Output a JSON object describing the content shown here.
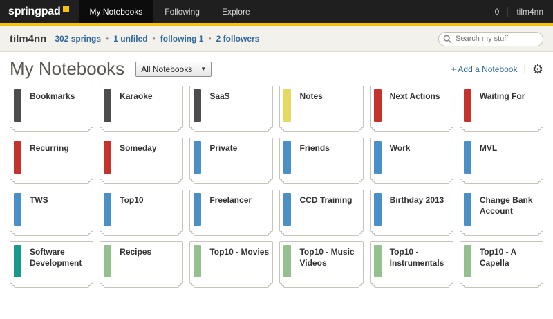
{
  "header": {
    "logo_text": "springpad",
    "tabs": [
      {
        "label": "My Notebooks",
        "active": true
      },
      {
        "label": "Following",
        "active": false
      },
      {
        "label": "Explore",
        "active": false
      }
    ],
    "notification_count": "0",
    "username": "tilm4nn"
  },
  "userbar": {
    "username": "tilm4nn",
    "stats": [
      {
        "label": "302 springs"
      },
      {
        "label": "1 unfiled"
      },
      {
        "label": "following 1"
      },
      {
        "label": "2 followers"
      }
    ],
    "search_placeholder": "Search my stuff"
  },
  "main": {
    "title": "My Notebooks",
    "filter_selected": "All Notebooks",
    "add_notebook_label": "+ Add a Notebook"
  },
  "colors": {
    "accent_yellow": "#f5c206",
    "link_blue": "#33699c"
  },
  "notebooks": [
    {
      "title": "Bookmarks",
      "color": "#4d4d4d"
    },
    {
      "title": "Karaoke",
      "color": "#4d4d4d"
    },
    {
      "title": "SaaS",
      "color": "#4d4d4d"
    },
    {
      "title": "Notes",
      "color": "#e4da62"
    },
    {
      "title": "Next Actions",
      "color": "#c4342d"
    },
    {
      "title": "Waiting For",
      "color": "#c4342d"
    },
    {
      "title": "Recurring",
      "color": "#c4342d"
    },
    {
      "title": "Someday",
      "color": "#c4342d"
    },
    {
      "title": "Private",
      "color": "#4b8fc7"
    },
    {
      "title": "Friends",
      "color": "#4b8fc7"
    },
    {
      "title": "Work",
      "color": "#4b8fc7"
    },
    {
      "title": "MVL",
      "color": "#4b8fc7"
    },
    {
      "title": "TWS",
      "color": "#4b8fc7"
    },
    {
      "title": "Top10",
      "color": "#4b8fc7"
    },
    {
      "title": "Freelancer",
      "color": "#4b8fc7"
    },
    {
      "title": "CCD Training",
      "color": "#4b8fc7"
    },
    {
      "title": "Birthday 2013",
      "color": "#4b8fc7"
    },
    {
      "title": "Change Bank Account",
      "color": "#4b8fc7"
    },
    {
      "title": "Software Development",
      "color": "#18998b"
    },
    {
      "title": "Recipes",
      "color": "#93c08d"
    },
    {
      "title": "Top10 - Movies",
      "color": "#93c08d"
    },
    {
      "title": "Top10 - Music Videos",
      "color": "#93c08d"
    },
    {
      "title": "Top10 - Instrumentals",
      "color": "#93c08d"
    },
    {
      "title": "Top10 - A Capella",
      "color": "#93c08d"
    }
  ]
}
